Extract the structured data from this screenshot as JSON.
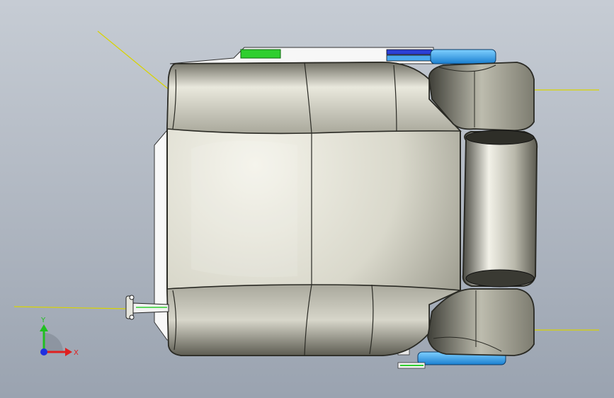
{
  "viewport": {
    "background_top": "#c6ccd4",
    "background_bottom": "#9aa3b0"
  },
  "model": {
    "shell_color": "#d8d7cb",
    "edge_color": "#2a2a24",
    "accent_green": "#2fcf2f",
    "accent_blue": "#2c9ee8",
    "accent_dark_blue": "#2c3fd6",
    "guide_line_color": "#d9d400"
  },
  "triad": {
    "x_label": "X",
    "y_label": "Y",
    "x_color": "#e02020",
    "y_color": "#20c020",
    "z_color": "#2030e0",
    "icon": "coordinate-triad-icon"
  }
}
